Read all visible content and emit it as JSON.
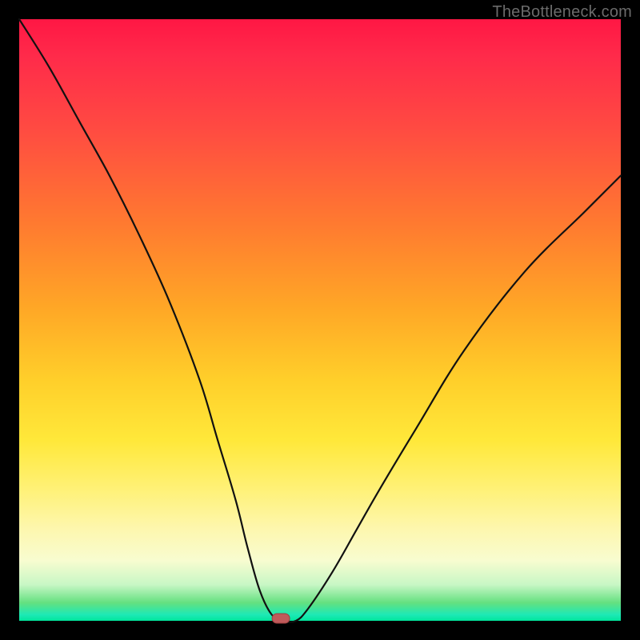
{
  "watermark": "TheBottleneck.com",
  "chart_data": {
    "type": "line",
    "title": "",
    "xlabel": "",
    "ylabel": "",
    "xlim": [
      0,
      100
    ],
    "ylim": [
      0,
      100
    ],
    "grid": false,
    "legend": false,
    "background_gradient": {
      "direction": "vertical",
      "stops": [
        {
          "pos": 0.0,
          "color": "#ff1744"
        },
        {
          "pos": 0.35,
          "color": "#ff7a30"
        },
        {
          "pos": 0.65,
          "color": "#ffe83a"
        },
        {
          "pos": 0.9,
          "color": "#f8fcd0"
        },
        {
          "pos": 1.0,
          "color": "#00e59b"
        }
      ]
    },
    "series": [
      {
        "name": "bottleneck-curve",
        "x": [
          0,
          5,
          10,
          15,
          20,
          25,
          30,
          33,
          36,
          38,
          40,
          42,
          44,
          46,
          48,
          52,
          56,
          60,
          66,
          74,
          84,
          94,
          100
        ],
        "y": [
          100,
          92,
          83,
          74,
          64,
          53,
          40,
          30,
          20,
          12,
          5,
          1,
          0,
          0,
          2,
          8,
          15,
          22,
          32,
          45,
          58,
          68,
          74
        ]
      }
    ],
    "marker": {
      "x": 43.5,
      "y": 0,
      "shape": "rounded-rect",
      "color": "#c05a5a"
    }
  }
}
